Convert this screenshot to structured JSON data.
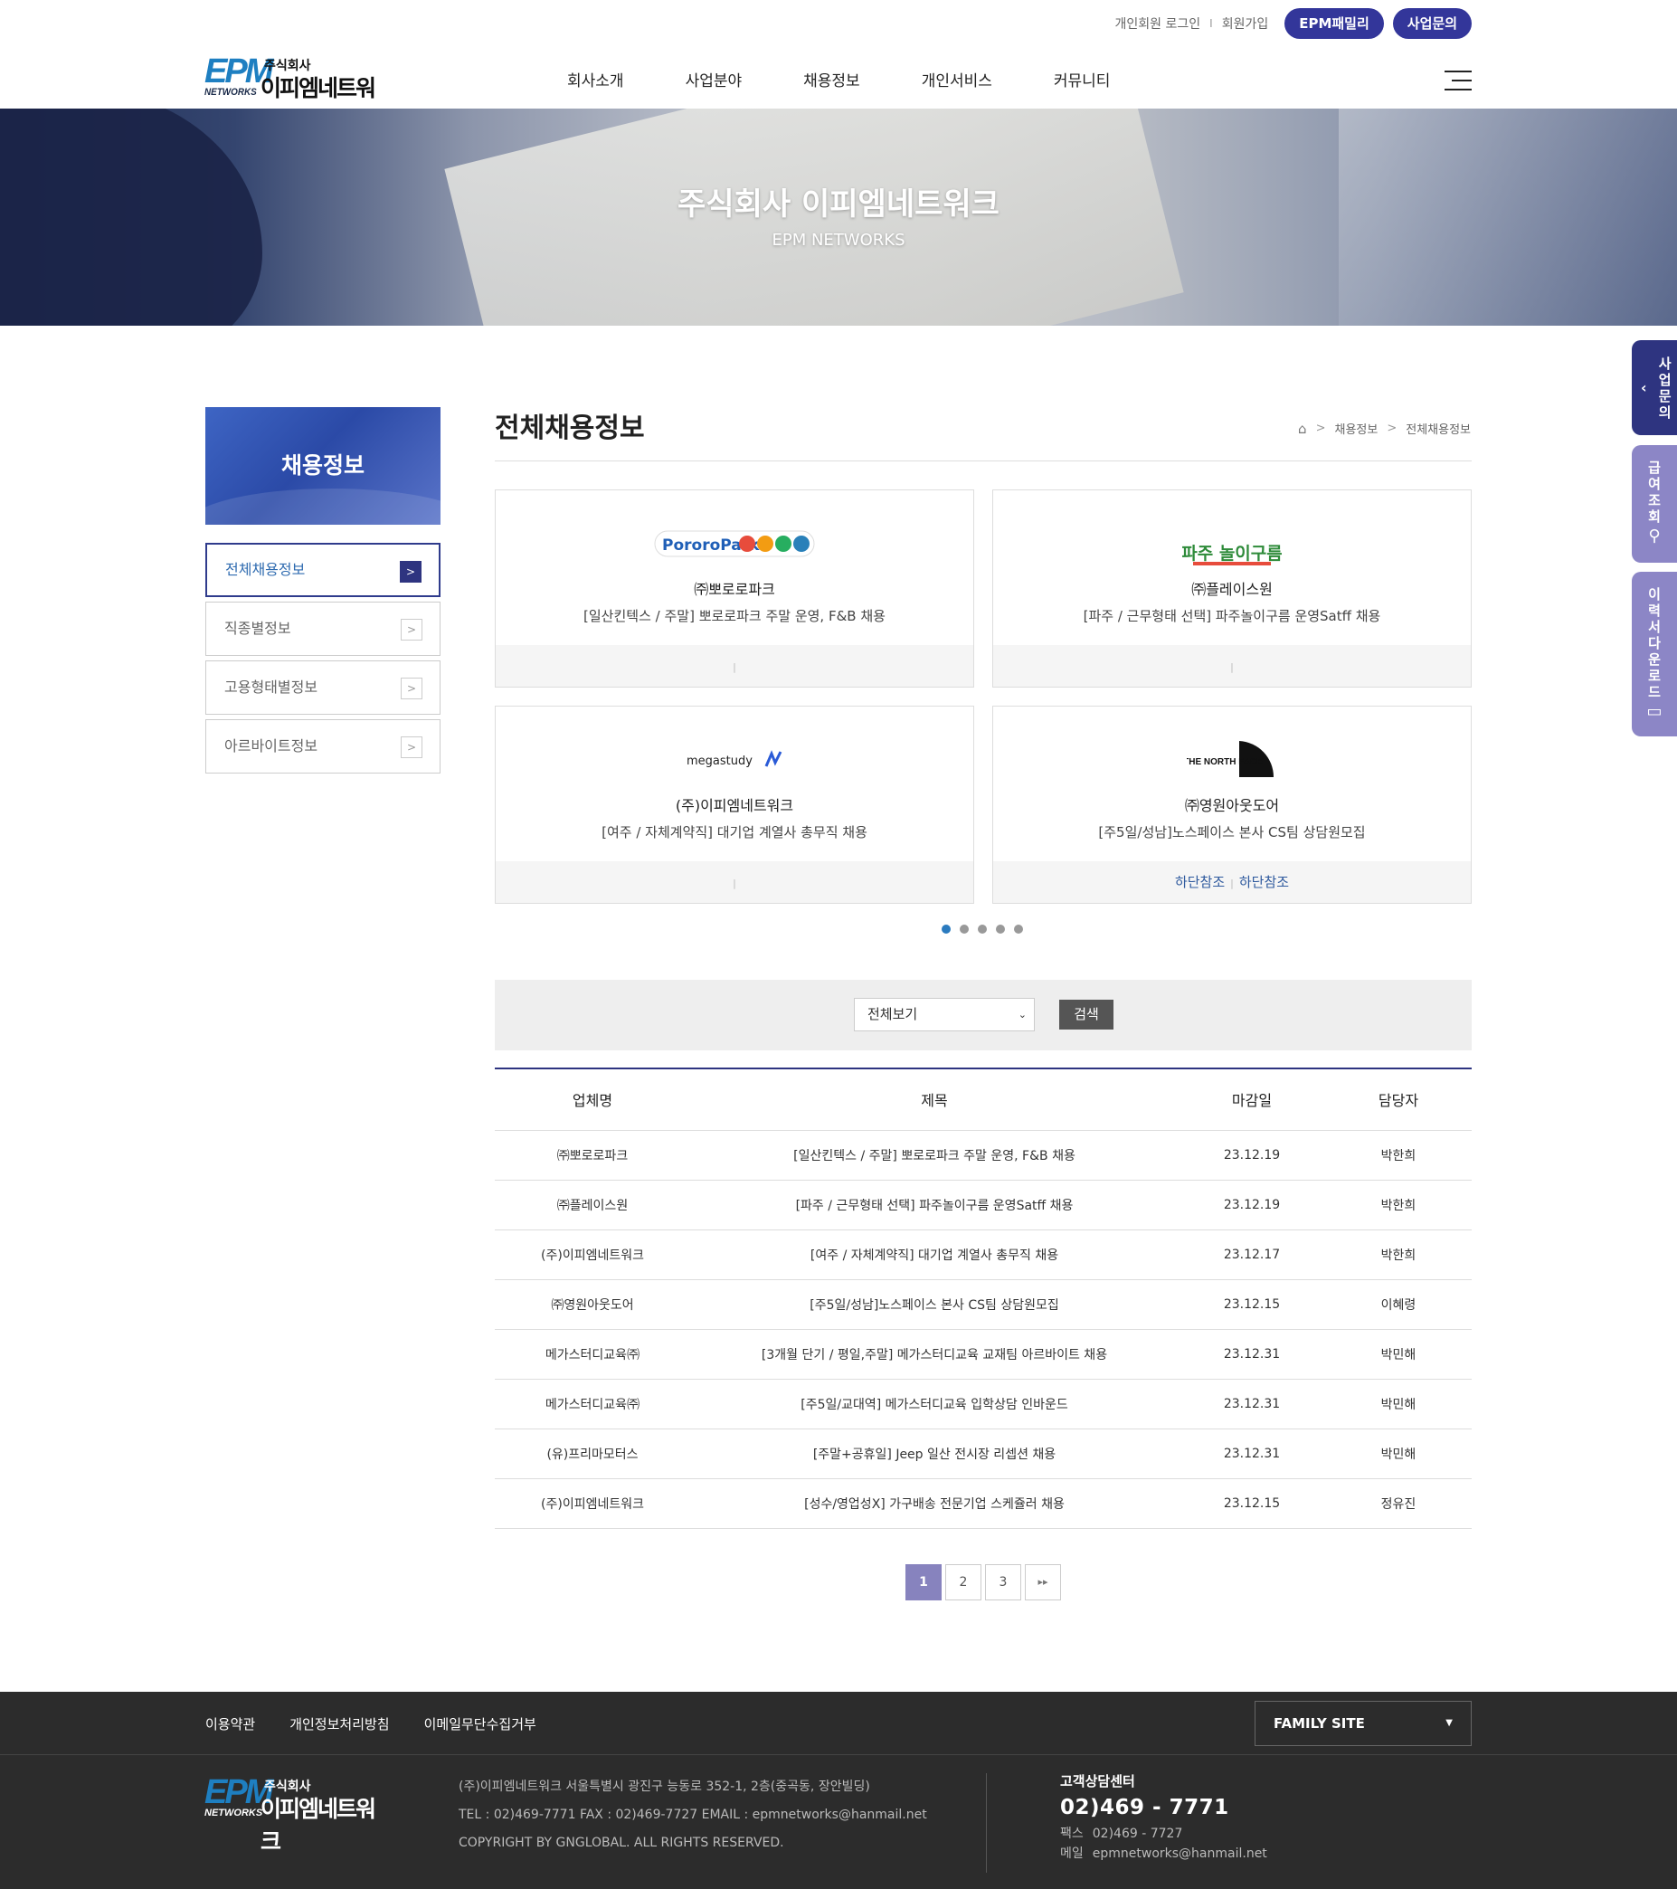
{
  "header": {
    "top_links": [
      "개인회원 로그인",
      "회원가입"
    ],
    "top_sep": "I",
    "pill_family": "EPM패밀리",
    "pill_inquiry": "사업문의",
    "logo": {
      "epm": "EPM",
      "networks": "NETWORKS",
      "jusik": "주식회사",
      "name": "이피엠네트워크"
    },
    "nav": [
      "회사소개",
      "사업분야",
      "채용정보",
      "개인서비스",
      "커뮤니티"
    ]
  },
  "hero": {
    "title": "주식회사 이피엠네트워크",
    "subtitle": "EPM NETWORKS"
  },
  "quick_tabs": [
    {
      "label": "사업문의",
      "icon": "chevron-left-icon"
    },
    {
      "label": "급여조회",
      "icon": "search-icon"
    },
    {
      "label": "이력서다운로드",
      "icon": "folder-icon"
    }
  ],
  "sidebar": {
    "title": "채용정보",
    "items": [
      "전체채용정보",
      "직종별정보",
      "고용형태별정보",
      "아르바이트정보"
    ],
    "active": 0
  },
  "content": {
    "title": "전체채용정보",
    "breadcrumb": [
      "채용정보",
      "전체채용정보"
    ]
  },
  "featured": [
    {
      "logo_text": "PororoPark",
      "company": "㈜뽀로로파크",
      "title": "[일산킨텍스 / 주말] 뽀로로파크 주말 운영, F&B 채용",
      "footer": [
        "",
        ""
      ]
    },
    {
      "logo_text": "파주 놀이구름",
      "company": "㈜플레이스원",
      "title": "[파주 / 근무형태 선택] 파주놀이구름 운영Satff 채용",
      "footer": [
        "",
        ""
      ]
    },
    {
      "logo_text": "megastudy",
      "company": "(주)이피엠네트워크",
      "title": "[여주 / 자체계약직] 대기업 계열사 총무직 채용",
      "footer": [
        "",
        ""
      ]
    },
    {
      "logo_text": "THE NORTH FACE",
      "company": "㈜영원아웃도어",
      "title": "[주5일/성남]노스페이스 본사 CS팀 상담원모집",
      "footer": [
        "하단참조",
        "하단참조"
      ]
    }
  ],
  "carousel": {
    "count": 5,
    "active": 0
  },
  "search": {
    "select_value": "전체보기",
    "button": "검색"
  },
  "table": {
    "headers": [
      "업체명",
      "제목",
      "마감일",
      "담당자"
    ],
    "rows": [
      [
        "㈜뽀로로파크",
        "[일산킨텍스 / 주말] 뽀로로파크 주말 운영, F&B 채용",
        "23.12.19",
        "박한희"
      ],
      [
        "㈜플레이스원",
        "[파주 / 근무형태 선택] 파주놀이구름 운영Satff 채용",
        "23.12.19",
        "박한희"
      ],
      [
        "(주)이피엠네트워크",
        "[여주 / 자체계약직] 대기업 계열사 총무직 채용",
        "23.12.17",
        "박한희"
      ],
      [
        "㈜영원아웃도어",
        "[주5일/성남]노스페이스 본사 CS팀 상담원모집",
        "23.12.15",
        "이혜령"
      ],
      [
        "메가스터디교육㈜",
        "[3개월 단기 / 평일,주말] 메가스터디교육 교재팀 아르바이트 채용",
        "23.12.31",
        "박민해"
      ],
      [
        "메가스터디교육㈜",
        "[주5일/교대역] 메가스터디교육 입학상담 인바운드",
        "23.12.31",
        "박민해"
      ],
      [
        "(유)프리마모터스",
        "[주말+공휴일] Jeep 일산 전시장 리셉션 채용",
        "23.12.31",
        "박민해"
      ],
      [
        "(주)이피엠네트워크",
        "[성수/영업성X] 가구배송 전문기업 스케쥴러 채용",
        "23.12.15",
        "정유진"
      ]
    ]
  },
  "pagination": {
    "pages": [
      "1",
      "2",
      "3"
    ],
    "active": 0,
    "next": "▸▸"
  },
  "footer": {
    "links": [
      "이용약관",
      "개인정보처리방침",
      "이메일무단수집거부"
    ],
    "family_site": "FAMILY SITE",
    "address": "(주)이피엠네트워크 서울특별시 광진구 능동로 352-1, 2층(중곡동, 장안빌딩)",
    "contact": "TEL : 02)469-7771 FAX : 02)469-7727 EMAIL : epmnetworks@hanmail.net",
    "copyright": "COPYRIGHT BY GNGLOBAL. ALL RIGHTS RESERVED.",
    "cs_title": "고객상담센터",
    "cs_tel": "02)469 - 7771",
    "fax_label": "팩스",
    "fax": "02)469 - 7727",
    "mail_label": "메일",
    "mail": "epmnetworks@hanmail.net"
  },
  "colors": {
    "brand_navy": "#2e3480",
    "brand_lavender": "#8783be",
    "logo_blue": "#1e7fc1",
    "footer_bg": "#2c2c2c"
  }
}
